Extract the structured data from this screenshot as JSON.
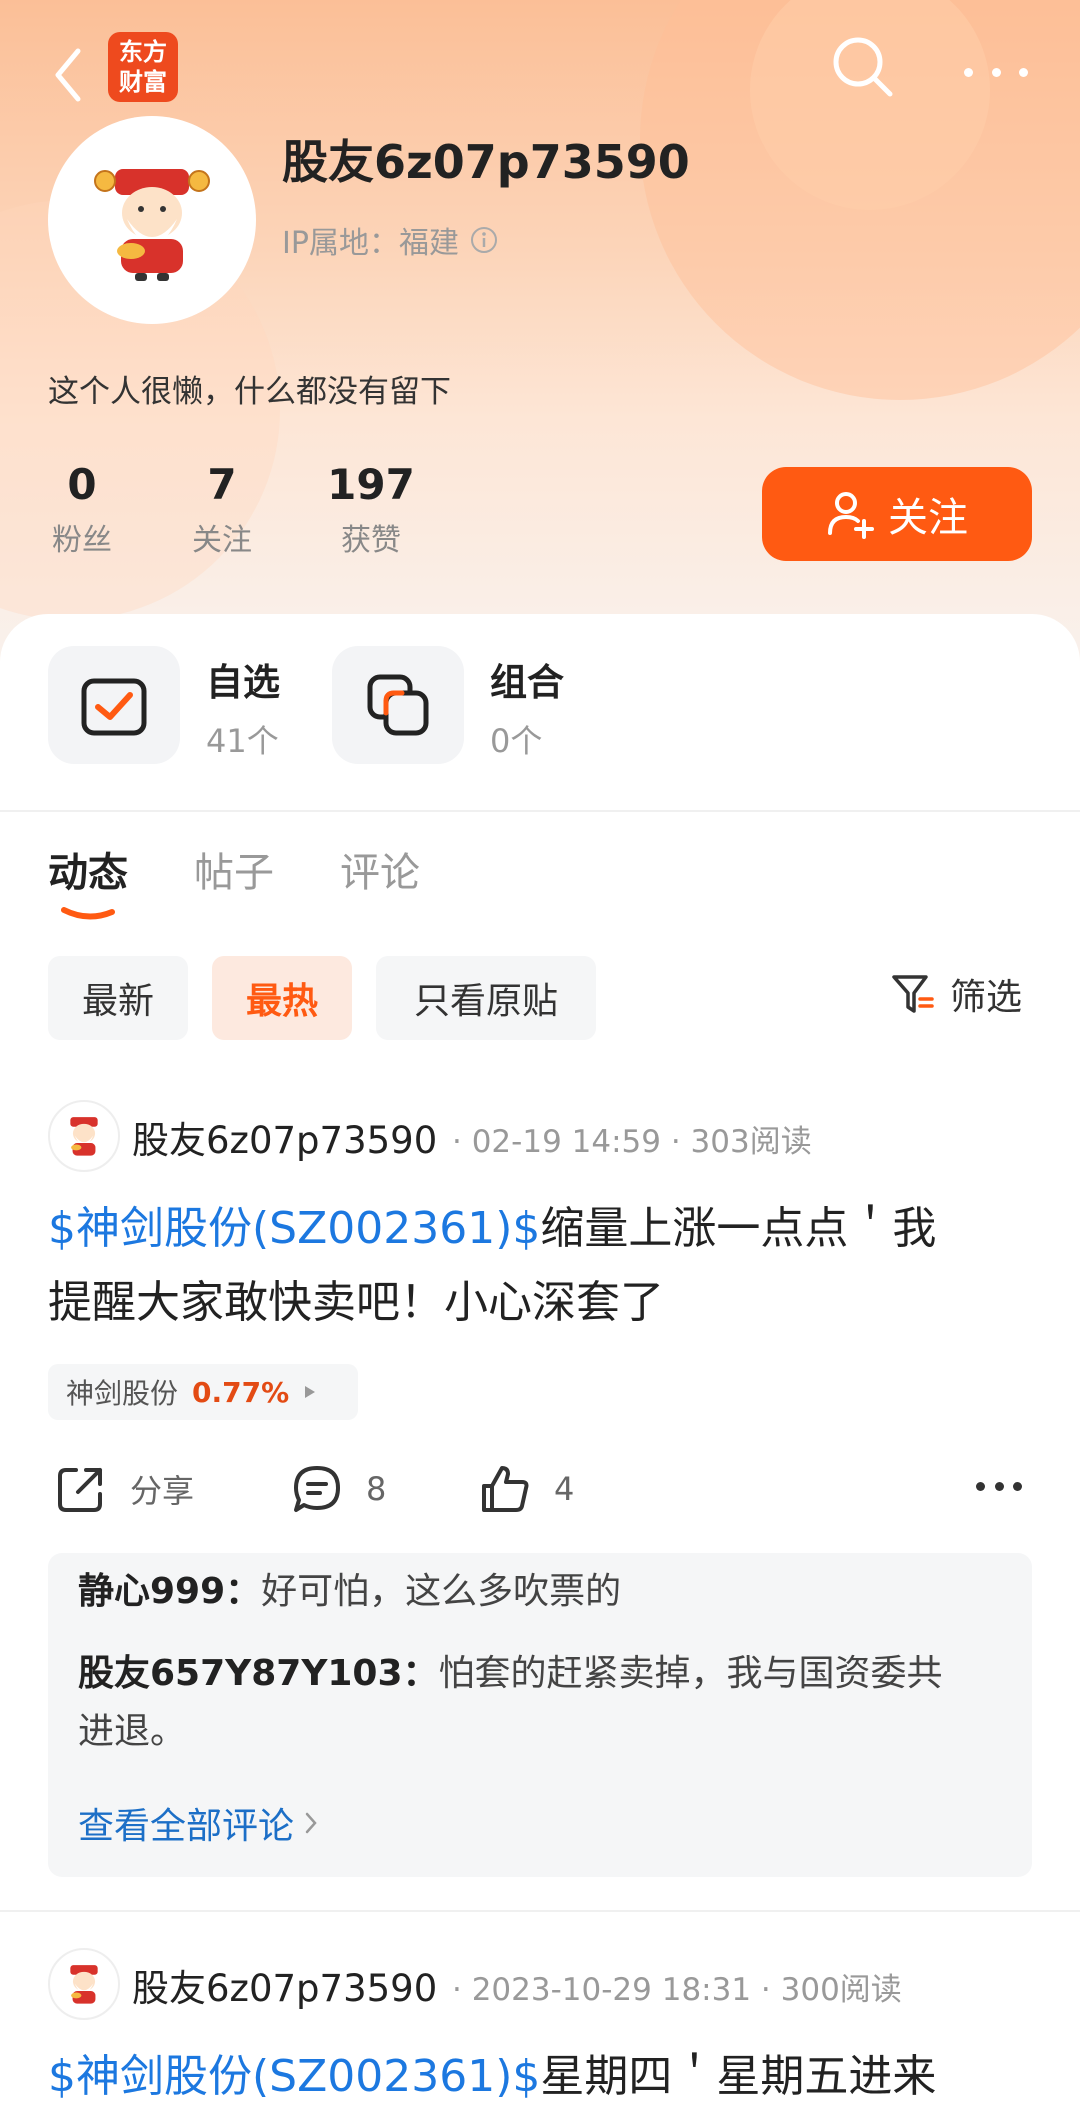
{
  "topbar": {
    "logo_line1": "东方",
    "logo_line2": "财富"
  },
  "profile": {
    "username": "股友6z07p73590",
    "ip_label": "IP属地：福建",
    "bio": "这个人很懒，什么都没有留下"
  },
  "stats": [
    {
      "num": "0",
      "label": "粉丝"
    },
    {
      "num": "7",
      "label": "关注"
    },
    {
      "num": "197",
      "label": "获赞"
    }
  ],
  "follow_label": "关注",
  "shortcuts": [
    {
      "title": "自选",
      "count": "41个"
    },
    {
      "title": "组合",
      "count": "0个"
    }
  ],
  "tabs": [
    "动态",
    "帖子",
    "评论"
  ],
  "chips": [
    "最新",
    "最热",
    "只看原贴"
  ],
  "filter_label": "筛选",
  "posts": [
    {
      "author": "股友6z07p73590",
      "meta": "· 02-19 14:59 · 303阅读",
      "stock_link": "$神剑股份(SZ002361)$",
      "text_line1": "缩量上涨一点点＇我",
      "text_line2": "提醒大家敢快卖吧！小心深套了",
      "stock_chip_name": "神剑股份",
      "stock_chip_pct": "0.77%",
      "share_label": "分享",
      "comment_count": "8",
      "like_count": "4",
      "comments": [
        {
          "user": "静心999：",
          "text": "好可怕，这么多吹票的"
        },
        {
          "user": "股友657Y87Y103：",
          "text": "怕套的赶紧卖掉，我与国资委共",
          "text2": "进退。"
        }
      ],
      "view_all": "查看全部评论"
    },
    {
      "author": "股友6z07p73590",
      "meta": "· 2023-10-29 18:31 · 300阅读",
      "stock_link": "$神剑股份(SZ002361)$",
      "text_line1": "星期四＇星期五进来"
    }
  ],
  "colors": {
    "accent": "#ff5a12",
    "link": "#1c78e0",
    "gain": "#e34b14"
  }
}
